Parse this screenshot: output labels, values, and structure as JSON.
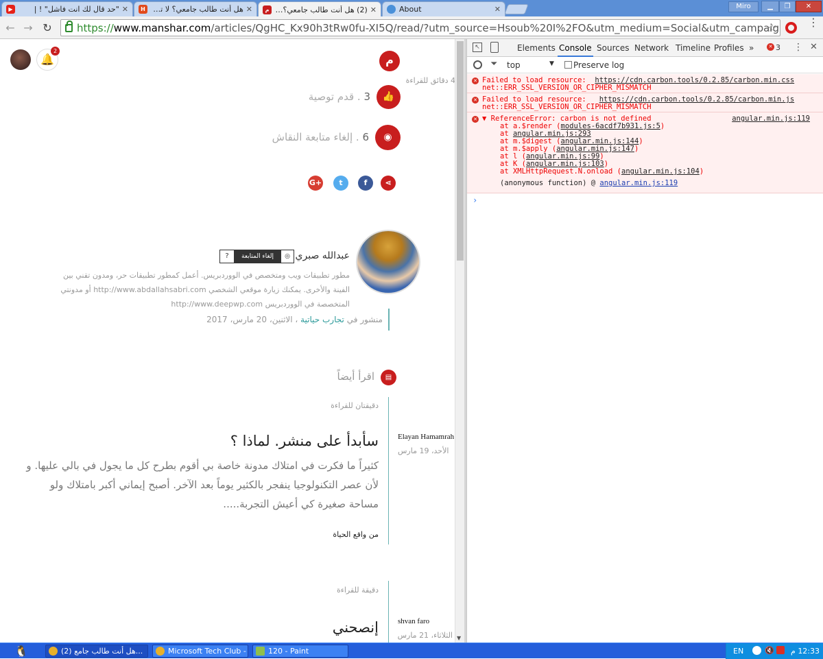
{
  "browser": {
    "tabs": [
      {
        "title": "\"حد قال لك انت فاشل\" ! |",
        "favicon": "youtube-icon",
        "color": "#e62117"
      },
      {
        "title": "هل أنت طالب جامعي؟ لا تقعد",
        "favicon": "hsoub-icon",
        "color": "#e24a1b"
      },
      {
        "title": "(2) هل أنت طالب جامعي؟ لا ت",
        "favicon": "manshar-icon",
        "color": "#c81e1e"
      },
      {
        "title": "About",
        "favicon": "chrome-icon",
        "color": "#4a90d9"
      }
    ],
    "profile_name": "Miro",
    "url_scheme": "https://",
    "url_host": "www.manshar.com",
    "url_path": "/articles/QgHC_Kx90h3tRw0fu-XI5Q/read/?utm_source=Hsoub%20I%2FO&utm_medium=Social&utm_campaign=Hsoub%",
    "icons": {
      "back": "back-arrow-icon",
      "forward": "forward-arrow-icon",
      "reload": "reload-icon",
      "star": "star-icon",
      "opera": "opera-icon",
      "menu": "menu-icon"
    }
  },
  "article": {
    "notif_count": "2",
    "read_time": "4 دقائق للقراءة",
    "recommend_count": "3",
    "recommend_label": ". قدم توصية",
    "unfollow_count": "6",
    "unfollow_label": ". إلغاء متابعة النقاش",
    "author": {
      "name": "عبدالله صبري",
      "unfollow_btn": "إلغاء المتابعة",
      "q_mark": "?",
      "bio_line1": "مطور تطبيقات ويب ومتخصص في الووردبريس. أعمل كمطور تطبيقات حر، ومدون تقني بين",
      "bio_line2": "الفينة والأخرى. يمكنك زيارة موقعي الشخصي http://www.abdallahsabri.com أو مدونتي",
      "bio_line3": "المتخصصة في الووردبريس http://www.deepwp.com"
    },
    "published_prefix": "منشور في",
    "category": "تجارب حياتية",
    "published_date": "، الاثنين، 20 مارس، 2017",
    "read_also": "اقرأ أيضاً",
    "related": [
      {
        "read_time": "دقيقتان للقراءة",
        "author": "Elayan Hamamrah",
        "date": "الأحد، 19 مارس",
        "title": "سأبدأ على منشر. لماذا ؟",
        "excerpt1": "كثيراً ما فكرت في امتلاك مدونة خاصة بي أقوم بطرح كل ما يجول في بالي عليها. و",
        "excerpt2": "لأن عصر التكنولوجيا ينفجر بالكثير يوماً بعد الآخر. أصبح إيماني أكبر بامتلاك ولو",
        "excerpt3": "مساحة صغيرة كي أعيش التجربة.....",
        "tag": "من واقع الحياة"
      },
      {
        "read_time": "دقيقة للقراءة",
        "author": "shvan faro",
        "date": "الثلاثاء، 21 مارس",
        "title": "إنصحني"
      }
    ]
  },
  "devtools": {
    "tabs": [
      "Elements",
      "Console",
      "Sources",
      "Network",
      "Timeline",
      "Profiles"
    ],
    "active_tab": "Console",
    "more": "»",
    "error_count": "3",
    "context": "top",
    "preserve_log": "Preserve log",
    "messages": [
      {
        "text": "Failed to load resource:",
        "link": "https://cdn.carbon.tools/0.2.85/carbon.min.css",
        "detail": "net::ERR_SSL_VERSION_OR_CIPHER_MISMATCH"
      },
      {
        "text": "Failed to load resource:",
        "link": "https://cdn.carbon.tools/0.2.85/carbon.min.js",
        "detail": "net::ERR_SSL_VERSION_OR_CIPHER_MISMATCH"
      }
    ],
    "ref_error": {
      "title": "ReferenceError: carbon is not defined",
      "source": "angular.min.js:119",
      "stack": [
        {
          "pre": "at a.$render (",
          "link": "modules-6acdf7b931.js:5",
          "post": ")"
        },
        {
          "pre": "at ",
          "link": "angular.min.js:293",
          "post": ""
        },
        {
          "pre": "at m.$digest (",
          "link": "angular.min.js:144",
          "post": ")"
        },
        {
          "pre": "at m.$apply (",
          "link": "angular.min.js:147",
          "post": ")"
        },
        {
          "pre": "at l (",
          "link": "angular.min.js:99",
          "post": ")"
        },
        {
          "pre": "at K (",
          "link": "angular.min.js:103",
          "post": ")"
        },
        {
          "pre": "at XMLHttpRequest.N.onload (",
          "link": "angular.min.js:104",
          "post": ")"
        }
      ],
      "anon_pre": "(anonymous function) @ ",
      "anon_link": "angular.min.js:119"
    },
    "prompt": "›"
  },
  "taskbar": {
    "tasks": [
      "هل أنت طالب جامع (2)...",
      "Microsoft Tech Club - ...",
      "120 - Paint"
    ],
    "lang": "EN",
    "time": "12:33 م"
  }
}
